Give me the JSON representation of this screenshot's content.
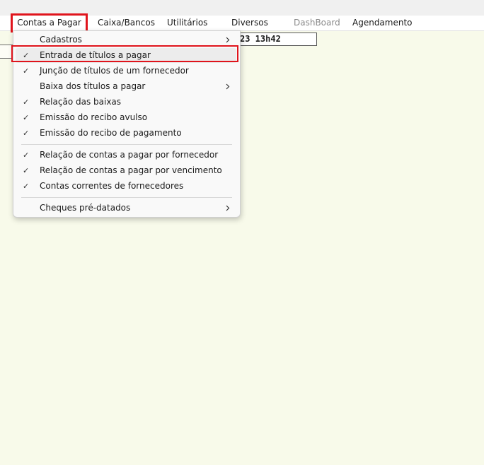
{
  "menubar": {
    "items": [
      {
        "label": "Contas a Pagar"
      },
      {
        "label": "Caixa/Bancos"
      },
      {
        "label": "Utilitários"
      },
      {
        "label": "Diversos"
      },
      {
        "label": "DashBoard"
      },
      {
        "label": "Agendamento"
      }
    ]
  },
  "clock": {
    "text": "23 13h42"
  },
  "dropdown": {
    "items": [
      {
        "label": "Cadastros",
        "checked": false,
        "submenu": true
      },
      {
        "label": "Entrada de títulos a pagar",
        "checked": true,
        "submenu": false,
        "hovered": true
      },
      {
        "label": "Junção de títulos de um fornecedor",
        "checked": true,
        "submenu": false
      },
      {
        "label": "Baixa dos títulos a pagar",
        "checked": false,
        "submenu": true
      },
      {
        "label": "Relação das baixas",
        "checked": true,
        "submenu": false
      },
      {
        "label": "Emissão do recibo avulso",
        "checked": true,
        "submenu": false
      },
      {
        "label": "Emissão do recibo de pagamento",
        "checked": true,
        "submenu": false
      },
      {
        "label": "Relação de contas a pagar por fornecedor",
        "checked": true,
        "submenu": false
      },
      {
        "label": "Relação de contas a pagar por vencimento",
        "checked": true,
        "submenu": false
      },
      {
        "label": "Contas correntes de fornecedores",
        "checked": true,
        "submenu": false
      },
      {
        "label": "Cheques pré-datados",
        "checked": false,
        "submenu": true
      }
    ],
    "check_glyph": "✓",
    "chevron_icon": "chevron-right-icon"
  },
  "colors": {
    "background": "#f8faea",
    "highlight_outline": "#e0141c",
    "hover_row": "#ececec"
  }
}
